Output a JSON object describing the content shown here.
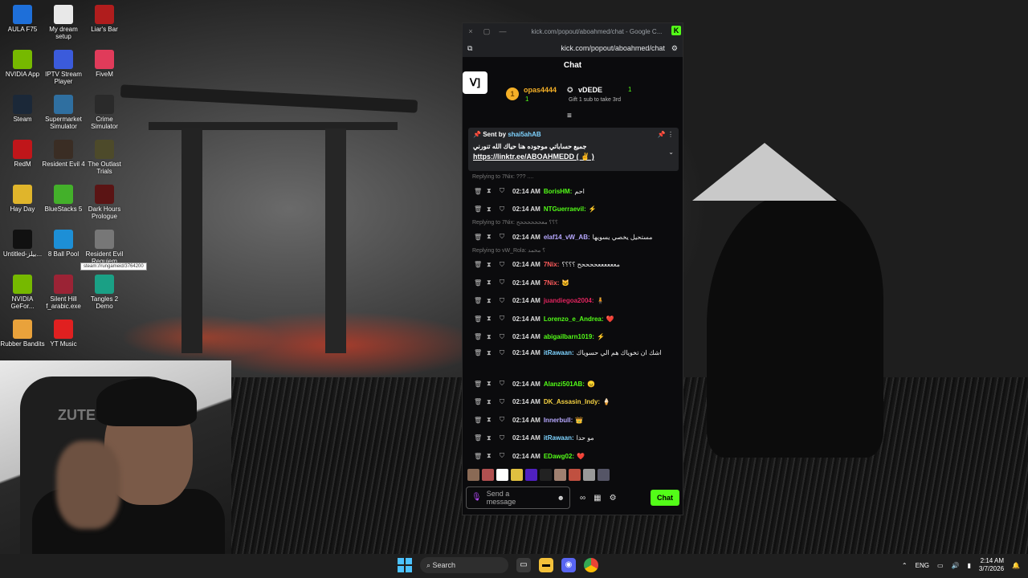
{
  "desktop": {
    "icons": [
      {
        "label": "AULA F75",
        "color": "#1e6fd9"
      },
      {
        "label": "My dream setup",
        "color": "#e8e8e8"
      },
      {
        "label": "Liar's Bar",
        "color": "#b01d1d"
      },
      {
        "label": "NVIDIA App",
        "color": "#76b900"
      },
      {
        "label": "IPTV Stream Player",
        "color": "#3b5bdb"
      },
      {
        "label": "FiveM",
        "color": "#e03b5a"
      },
      {
        "label": "Steam",
        "color": "#1b2838"
      },
      {
        "label": "Supermarket Simulator",
        "color": "#2f6fa0"
      },
      {
        "label": "Crime Simulator",
        "color": "#2a2a2a"
      },
      {
        "label": "RedM",
        "color": "#c0161a"
      },
      {
        "label": "Resident Evil 4",
        "color": "#3a2d24"
      },
      {
        "label": "The Outlast Trials",
        "color": "#4d4a2a"
      },
      {
        "label": "Hay Day",
        "color": "#e0b52b"
      },
      {
        "label": "BlueStacks 5",
        "color": "#43b02a"
      },
      {
        "label": "Dark Hours Prologue",
        "color": "#5a1414"
      },
      {
        "label": "Untitled-بيلز...",
        "color": "#111111"
      },
      {
        "label": "8 Ball Pool",
        "color": "#1d8fd6"
      },
      {
        "label": "Resident Evil Requiem",
        "color": "#777777"
      },
      {
        "label": "NVIDIA GeFor...",
        "color": "#76b900"
      },
      {
        "label": "Silent Hill f_arabic.exe",
        "color": "#9b2335"
      },
      {
        "label": "Tangles 2 Demo",
        "color": "#1aa085"
      },
      {
        "label": "Rubber Bandits",
        "color": "#e9a23b"
      },
      {
        "label": "YT Music",
        "color": "#e02020"
      }
    ],
    "tooltip": "steam://rungameid/3764200"
  },
  "webcam": {
    "chair_brand": "ZUTE"
  },
  "browser": {
    "title": "kick.com/popout/aboahmed/chat - Google C...",
    "url": "kick.com/popout/aboahmed/chat",
    "controls": {
      "close": "×",
      "restore": "▢",
      "minimize": "—"
    },
    "chat_header": "Chat",
    "logo": "ᐯ]",
    "leaderboard": {
      "first_user": "opas4444",
      "first_rank": "1",
      "first_count": "1",
      "second_user": "vDEDE",
      "second_count": "1",
      "gift_text": "Gift 1 sub to take 3rd"
    },
    "pinned": {
      "sent_by": "Sent by",
      "user": "shai5ahAB",
      "text": "جميع حساباتي موجوده هنا حياك الله تنورني",
      "link": "https://linktr.ee/ABOAHMEDD ( ✌️ )"
    },
    "messages": [
      {
        "reply": "Replying to 7Nix: ??? ....",
        "time": "",
        "user": "",
        "text": ""
      },
      {
        "time": "02:14 AM",
        "user": "BorisHM:",
        "color": "#53fc18",
        "text": "احم"
      },
      {
        "time": "02:14 AM",
        "user": "NTGuerraevil:",
        "color": "#53fc18",
        "text": "⚡"
      },
      {
        "reply": "Replying to 7Nix: ؟؟؟ معححححححح",
        "time": "02:14 AM",
        "user": "elaf14_vW_AB:",
        "color": "#b7a8ff",
        "text": "مستحيل يخصي يسويها"
      },
      {
        "reply": "Replying to vW_Rola: ؟ محمد",
        "time": "02:14 AM",
        "user": "7Nix:",
        "color": "#ff5c5c",
        "text": "مععععععححححح ؟؟؟؟"
      },
      {
        "time": "02:14 AM",
        "user": "7Nix:",
        "color": "#ff5c5c",
        "text": "🐱"
      },
      {
        "time": "02:14 AM",
        "user": "juandiegoa2004:",
        "color": "#e0245e",
        "text": "🧍"
      },
      {
        "time": "02:14 AM",
        "user": "Lorenzo_e_Andrea:",
        "color": "#53fc18",
        "text": "❤️"
      },
      {
        "time": "02:14 AM",
        "user": "abigailbarn1019:",
        "color": "#53fc18",
        "text": "⚡"
      },
      {
        "time": "02:14 AM",
        "user": "itRawaan:",
        "color": "#7ed3ff",
        "text": "اشك ان تخوياك هم الي حسوياك"
      },
      {
        "time": "02:14 AM",
        "user": "Alanzi501AB:",
        "color": "#53fc18",
        "text": "😠"
      },
      {
        "time": "02:14 AM",
        "user": "DK_Assasin_Indy:",
        "color": "#f5d142",
        "text": "🍦"
      },
      {
        "time": "02:14 AM",
        "user": "Innerbull:",
        "color": "#b7a8ff",
        "text": "👑"
      },
      {
        "time": "02:14 AM",
        "user": "itRawaan:",
        "color": "#7ed3ff",
        "text": "مو حدا"
      },
      {
        "time": "02:14 AM",
        "user": "EDawg02:",
        "color": "#53fc18",
        "text": "❤️"
      }
    ],
    "input_placeholder": "Send a message",
    "chat_button": "Chat"
  },
  "taskbar": {
    "search": "Search",
    "language": "ENG",
    "time": "2:14 AM",
    "date": "3/7/2026"
  }
}
